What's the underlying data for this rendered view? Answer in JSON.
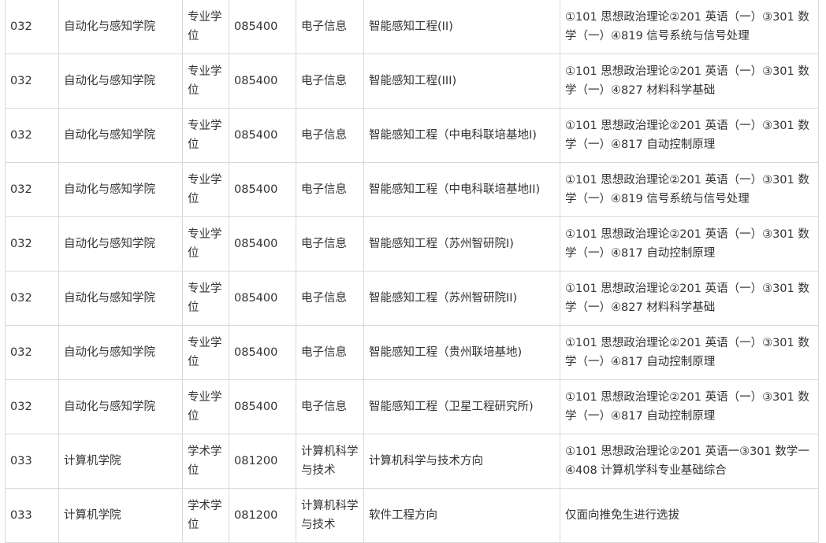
{
  "rows": [
    {
      "code": "032",
      "school": "自动化与感知学院",
      "type": "专业学位",
      "major_code": "085400",
      "major": "电子信息",
      "direction": "智能感知工程(II)",
      "subjects": "①101 思想政治理论②201 英语（一）③301 数学（一）④819 信号系统与信号处理"
    },
    {
      "code": "032",
      "school": "自动化与感知学院",
      "type": "专业学位",
      "major_code": "085400",
      "major": "电子信息",
      "direction": "智能感知工程(III)",
      "subjects": "①101 思想政治理论②201 英语（一）③301 数学（一）④827 材料科学基础"
    },
    {
      "code": "032",
      "school": "自动化与感知学院",
      "type": "专业学位",
      "major_code": "085400",
      "major": "电子信息",
      "direction": "智能感知工程（中电科联培基地I)",
      "subjects": "①101 思想政治理论②201 英语（一）③301 数学（一）④817 自动控制原理"
    },
    {
      "code": "032",
      "school": "自动化与感知学院",
      "type": "专业学位",
      "major_code": "085400",
      "major": "电子信息",
      "direction": "智能感知工程（中电科联培基地II)",
      "subjects": "①101 思想政治理论②201 英语（一）③301 数学（一）④819 信号系统与信号处理"
    },
    {
      "code": "032",
      "school": "自动化与感知学院",
      "type": "专业学位",
      "major_code": "085400",
      "major": "电子信息",
      "direction": "智能感知工程（苏州智研院I)",
      "subjects": "①101 思想政治理论②201 英语（一）③301 数学（一）④817 自动控制原理"
    },
    {
      "code": "032",
      "school": "自动化与感知学院",
      "type": "专业学位",
      "major_code": "085400",
      "major": "电子信息",
      "direction": "智能感知工程（苏州智研院II)",
      "subjects": "①101 思想政治理论②201 英语（一）③301 数学（一）④827 材料科学基础"
    },
    {
      "code": "032",
      "school": "自动化与感知学院",
      "type": "专业学位",
      "major_code": "085400",
      "major": "电子信息",
      "direction": "智能感知工程（贵州联培基地)",
      "subjects": "①101 思想政治理论②201 英语（一）③301 数学（一）④817 自动控制原理"
    },
    {
      "code": "032",
      "school": "自动化与感知学院",
      "type": "专业学位",
      "major_code": "085400",
      "major": "电子信息",
      "direction": "智能感知工程（卫星工程研究所)",
      "subjects": "①101 思想政治理论②201 英语（一）③301 数学（一）④817 自动控制原理"
    },
    {
      "code": "033",
      "school": "计算机学院",
      "type": "学术学位",
      "major_code": "081200",
      "major": "计算机科学与技术",
      "direction": "计算机科学与技术方向",
      "subjects": "①101 思想政治理论②201 英语一③301 数学一④408 计算机学科专业基础综合"
    },
    {
      "code": "033",
      "school": "计算机学院",
      "type": "学术学位",
      "major_code": "081200",
      "major": "计算机科学与技术",
      "direction": "软件工程方向",
      "subjects": "仅面向推免生进行选拔"
    }
  ]
}
